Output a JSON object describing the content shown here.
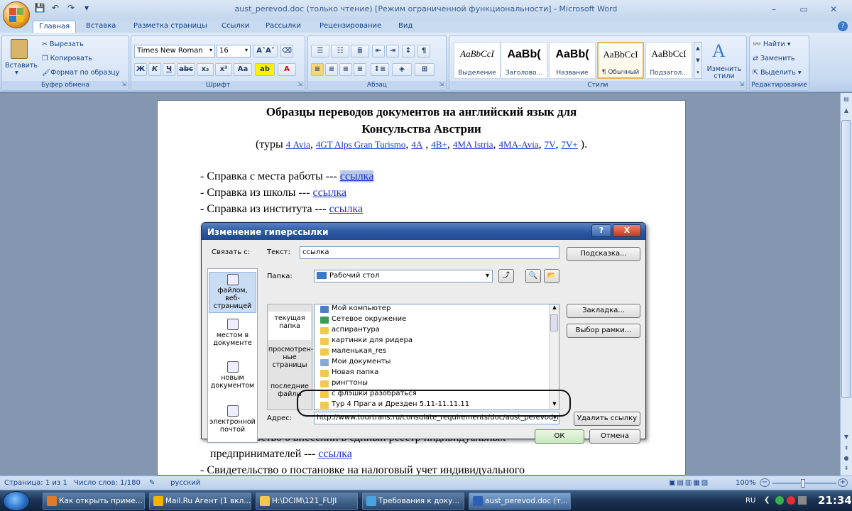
{
  "window": {
    "title": "aust_perevod.doc (только чтение) [Режим ограниченной функциональности] - Microsoft Word",
    "minimize": "–",
    "restore": "▭",
    "close": "✕"
  },
  "tabs": [
    "Главная",
    "Вставка",
    "Разметка страницы",
    "Ссылки",
    "Рассылки",
    "Рецензирование",
    "Вид"
  ],
  "ribbon": {
    "clipboard": {
      "label": "Буфер обмена",
      "paste": "Вставить",
      "cut": "Вырезать",
      "copy": "Копировать",
      "format": "Формат по образцу"
    },
    "font": {
      "label": "Шрифт",
      "name": "Times New Roman",
      "size": "16"
    },
    "paragraph": {
      "label": "Абзац"
    },
    "styles": {
      "label": "Стили",
      "items": [
        {
          "preview": "AaBbCcI",
          "name": "Выделение"
        },
        {
          "preview": "AaBb(",
          "name": "Заголово..."
        },
        {
          "preview": "AaBb(",
          "name": "Название"
        },
        {
          "preview": "AaBbCcI",
          "name": "¶ Обычный"
        },
        {
          "preview": "AaBbCcI",
          "name": "Подзагол..."
        }
      ],
      "change": "Изменить стили"
    },
    "editing": {
      "label": "Редактирование",
      "find": "Найти",
      "replace": "Заменить",
      "select": "Выделить"
    }
  },
  "document": {
    "title_line1": "Образцы переводов документов на английский язык для",
    "title_line2": "Консульства Австрии",
    "tours_open": "(туры ",
    "tours": [
      "4 Avia",
      "4GT Alps Gran Turismo",
      "4A",
      "4B+",
      "4MA Istria",
      "4MA-Avia",
      "7V",
      "7V+"
    ],
    "tours_close": ").",
    "lines": [
      {
        "text": "- Справка с места работы --- ",
        "link": "ссылка"
      },
      {
        "text": "- Справка из школы --- ",
        "link": "ссылка"
      },
      {
        "text": "- Справка из института  --- ",
        "link": "ссылка"
      }
    ],
    "partial1": "Свидетельство  о внесении в единый реестр индивидуальных",
    "partial2_text": "предпринимателей  --- ",
    "partial2_link": "ссылка",
    "partial3": "- Свидетельство  о постановке на налоговый учет индивидуального"
  },
  "dialog": {
    "title": "Изменение гиперссылки",
    "link_to": "Связать с:",
    "text_label": "Текст:",
    "text_value": "ссылка",
    "hint_btn": "Подсказка...",
    "folder_label": "Папка:",
    "folder_value": "Рабочий стол",
    "bookmark_btn": "Закладка...",
    "frame_btn": "Выбор рамки...",
    "link_types": [
      "файлом, веб-страницей",
      "местом в документе",
      "новым документом",
      "электронной почтой"
    ],
    "sub_views": [
      "текущая папка",
      "просмотрен-ные страницы",
      "последние файлы"
    ],
    "files": [
      "Мой компьютер",
      "Сетевое окружение",
      "аспирантура",
      "картинки для ридера",
      "маленькая_res",
      "Мои документы",
      "Новая папка",
      "рингтоны",
      "с флэшки разобраться",
      "Тур 4 Прага и Дрезден 5.11-11.11.11"
    ],
    "address_label": "Адрес:",
    "address_value": "http://www.tourtrans.ru/consulate_requirements/doc/aust_perevod_rat",
    "remove_btn": "Удалить ссылку",
    "ok": "ОК",
    "cancel": "Отмена",
    "help": "?",
    "close": "X"
  },
  "status": {
    "page": "Страница: 1 из 1",
    "words": "Число слов: 1/180",
    "lang": "русский",
    "zoom": "100%"
  },
  "taskbar": {
    "items": [
      "Как открыть приме...",
      "Mail.Ru Агент (1 вкл...",
      "H:\\DCIM\\121_FUJI",
      "Требования к доку...",
      "aust_perevod.doc (т..."
    ],
    "lang": "RU",
    "time": "21:34"
  },
  "colors": {
    "link": "#1a2fd8",
    "ribbon": "#c6d9f0",
    "dialog_title": "#2e5aa3"
  }
}
